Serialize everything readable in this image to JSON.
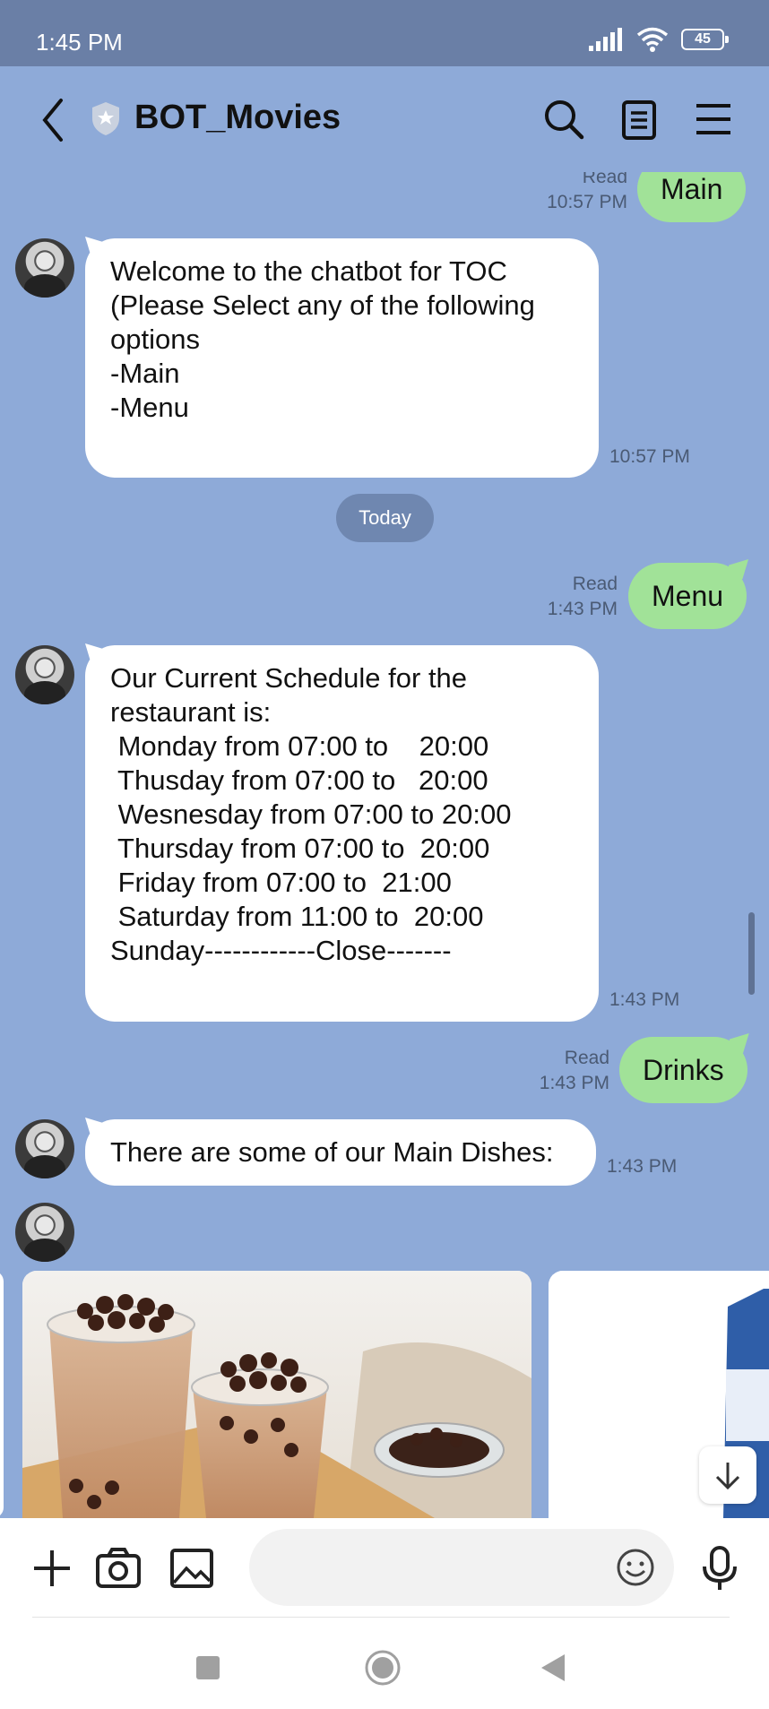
{
  "status": {
    "time": "1:45 PM",
    "battery": "45"
  },
  "header": {
    "title": "BOT_Movies"
  },
  "messages": {
    "m1": {
      "text": "Main",
      "read": "Read",
      "time": "10:57 PM"
    },
    "m2": {
      "text": "Welcome to the chatbot for TOC\n(Please Select any of the following\noptions\n-Main\n-Menu",
      "time": "10:57 PM"
    },
    "date_divider": "Today",
    "m3": {
      "text": "Menu",
      "read": "Read",
      "time": "1:43 PM"
    },
    "m4": {
      "text": "Our Current Schedule for the\nrestaurant is:\n Monday from 07:00 to    20:00\n Thusday from 07:00 to   20:00\n Wesnesday from 07:00 to 20:00\n Thursday from 07:00 to  20:00\n Friday from 07:00 to  21:00\n Saturday from 11:00 to  20:00\nSunday------------Close-------",
      "time": "1:43 PM"
    },
    "m5": {
      "text": "Drinks",
      "read": "Read",
      "time": "1:43 PM"
    },
    "m6": {
      "text": "There are some of our Main Dishes:",
      "time": "1:43 PM"
    }
  },
  "input": {
    "placeholder": ""
  },
  "colors": {
    "background": "#8eaad8",
    "status_bar": "#6a7fa6",
    "bubble_mine": "#a1e298",
    "bubble_bot": "#ffffff"
  }
}
